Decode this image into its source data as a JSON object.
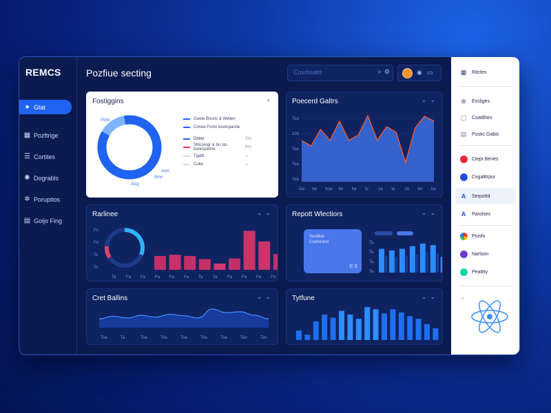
{
  "app": {
    "brand": "REMCS",
    "page_title": "Pozfiue secting"
  },
  "sidebar": {
    "items": [
      {
        "label": "Gtat",
        "icon": "chat-bubble-icon",
        "active": true
      },
      {
        "label": "Pozftrige",
        "icon": "grid-icon"
      },
      {
        "label": "Cortites",
        "icon": "list-icon"
      },
      {
        "label": "Dograbls",
        "icon": "gear-icon"
      },
      {
        "label": "Porupitos",
        "icon": "cog-icon"
      },
      {
        "label": "Goijo Fing",
        "icon": "document-icon"
      }
    ]
  },
  "search": {
    "placeholder": "Cosrbsatd"
  },
  "cards": {
    "donut": {
      "title": "Fostiggins",
      "labels": [
        "Poltn",
        "Aom",
        "Wnn",
        "Alsg"
      ],
      "legend": [
        {
          "label": "Gaote Bouns & Wellen",
          "color": "#1f63f0"
        },
        {
          "label": "Conoe Fosto bootcpanne",
          "color": "#1f63f0"
        },
        {
          "label": "Dbtlet",
          "color": "#1f63f0",
          "pct": "2%"
        },
        {
          "label": "Shlcoingr & bn sto bonrcpanne",
          "color": "#e8384f",
          "pct": "8%"
        },
        {
          "label": "Tgaltt",
          "color": "#d8dbe6",
          "pct": ""
        },
        {
          "label": "Culte",
          "color": "#d8dbe6",
          "pct": ""
        }
      ]
    },
    "area": {
      "title": "Poecerd Galtrs",
      "y_ticks": [
        "Toa",
        "103",
        "Toa",
        "Toa",
        "Toa"
      ],
      "x_ticks": [
        "Ga",
        "ba",
        "boa",
        "bo",
        "ba",
        "io",
        "sa",
        "ta",
        "co",
        "bo",
        "ba"
      ]
    },
    "bars": {
      "title": "Rarlinee",
      "y_ticks": [
        "Fo",
        "Fo",
        "To",
        "To",
        "Bo"
      ],
      "x_ticks": [
        "Ta",
        "Fa",
        "Fa",
        "Fa",
        "Fa",
        "Fa",
        "Ta",
        "Ta",
        "Fa",
        "Fa",
        "Fa",
        "Fo"
      ]
    },
    "report": {
      "title": "Repott Wlectiors",
      "inner_title": "Seoltllat",
      "inner_subtitle": "Coeforand",
      "inner_badge": "E.S",
      "y_ticks": [
        "Ta",
        "Ta",
        "Ta",
        "Ta"
      ]
    },
    "wave": {
      "title": "Cret Ballins",
      "x_ticks": [
        "Toa",
        "Ta",
        "Toa",
        "Toa",
        "Toa",
        "Toa",
        "Toa",
        "Tan",
        "Tan"
      ]
    },
    "columns": {
      "title": "Tytfune"
    }
  },
  "chart_data": [
    {
      "type": "pie",
      "title": "Fostiggins",
      "labels": [
        "Blue",
        "Light blue"
      ],
      "values": [
        86,
        14
      ]
    },
    {
      "type": "area",
      "title": "Poecerd Galtrs",
      "x": [
        0,
        1,
        2,
        3,
        4,
        5,
        6,
        7,
        8,
        9,
        10,
        11,
        12,
        13,
        14
      ],
      "values": [
        60,
        52,
        76,
        60,
        88,
        60,
        68,
        96,
        60,
        80,
        72,
        28,
        78,
        95,
        88
      ],
      "ylim": [
        0,
        100
      ]
    },
    {
      "type": "bar",
      "title": "Rarlinee",
      "values": [
        22,
        24,
        22,
        17,
        10,
        18,
        62,
        45,
        25,
        28
      ],
      "ylim": [
        0,
        70
      ]
    },
    {
      "type": "bar",
      "title": "Repott Wlectiors",
      "values": [
        45,
        42,
        45,
        50,
        55,
        52,
        30
      ],
      "ylim": [
        0,
        60
      ]
    },
    {
      "type": "line",
      "title": "Cret Ballins",
      "values": [
        20,
        26,
        22,
        28,
        24,
        30,
        27,
        22,
        42,
        34,
        36,
        28,
        20
      ],
      "ylim": [
        0,
        50
      ]
    },
    {
      "type": "bar",
      "title": "Tytfune",
      "values": [
        18,
        10,
        35,
        48,
        42,
        55,
        48,
        40,
        62,
        58,
        50,
        58,
        52,
        45,
        40,
        30,
        22
      ],
      "ylim": [
        0,
        70
      ]
    }
  ],
  "right_panel": {
    "items": [
      {
        "label": "Ritctes",
        "icon": "grid-icon"
      },
      {
        "label": "Exsliges",
        "icon": "gear-icon"
      },
      {
        "label": "Coattlhes",
        "icon": "image-icon"
      },
      {
        "label": "Pustic Gabis",
        "icon": "layers-icon"
      },
      {
        "label": "Ctept Beries",
        "icon": "red-dot-icon"
      },
      {
        "label": "Cvgalttrpur",
        "icon": "blue-dot-icon"
      },
      {
        "label": "Serpottd",
        "icon": "a-icon"
      },
      {
        "label": "Parolses",
        "icon": "a-icon"
      },
      {
        "label": "Pnisfo",
        "icon": "palette-icon"
      },
      {
        "label": "Narlson",
        "icon": "purple-dot-icon"
      },
      {
        "label": "Peatlity",
        "icon": "teal-dot-icon"
      }
    ]
  }
}
